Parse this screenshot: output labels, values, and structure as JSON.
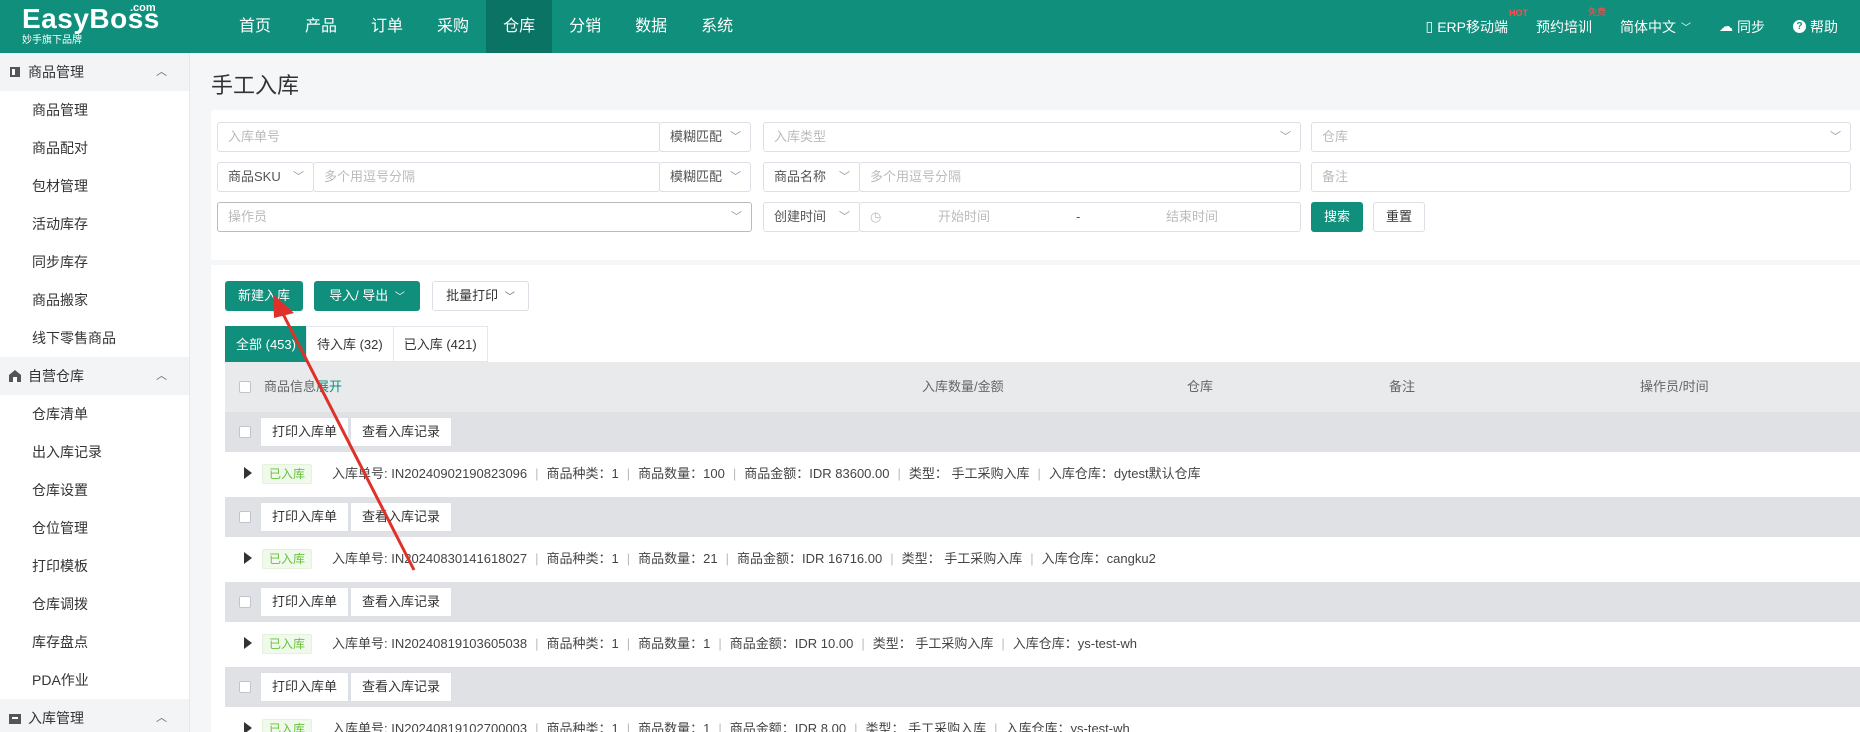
{
  "brand": {
    "name": "EasyBoss",
    "com": ".com",
    "sub": "妙手旗下品牌"
  },
  "nav": [
    "首页",
    "产品",
    "订单",
    "采购",
    "仓库",
    "分销",
    "数据",
    "系统"
  ],
  "nav_active": "仓库",
  "right_nav": {
    "erp": "ERP移动端",
    "erp_badge": "HOT",
    "train": "预约培训",
    "train_badge": "免费",
    "lang": "简体中文",
    "sync": "同步",
    "help": "帮助"
  },
  "sidebar": {
    "groups": [
      {
        "title": "商品管理",
        "icon": "product-icon",
        "items": [
          "商品管理",
          "商品配对",
          "包材管理",
          "活动库存",
          "同步库存",
          "商品搬家",
          "线下零售商品"
        ]
      },
      {
        "title": "自营仓库",
        "icon": "warehouse-icon",
        "items": [
          "仓库清单",
          "出入库记录",
          "仓库设置",
          "仓位管理",
          "打印模板",
          "仓库调拨",
          "库存盘点",
          "PDA作业"
        ]
      },
      {
        "title": "入库管理",
        "icon": "inbound-icon",
        "items": []
      }
    ]
  },
  "page": {
    "title": "手工入库"
  },
  "filters": {
    "order_no_placeholder": "入库单号",
    "fuzzy_match": "模糊匹配",
    "inbound_type_placeholder": "入库类型",
    "warehouse_placeholder": "仓库",
    "sku_label": "商品SKU",
    "multi_placeholder": "多个用逗号分隔",
    "product_name_label": "商品名称",
    "remark_placeholder": "备注",
    "operator_placeholder": "操作员",
    "time_type": "创建时间",
    "start_time": "开始时间",
    "end_time": "结束时间",
    "range_sep": "-",
    "search": "搜索",
    "reset": "重置"
  },
  "toolbar": {
    "new_inbound": "新建入库",
    "import_export": "导入/ 导出",
    "batch_print": "批量打印"
  },
  "tabs": [
    {
      "label": "全部 (453)",
      "active": true
    },
    {
      "label": "待入库 (32)",
      "active": false
    },
    {
      "label": "已入库 (421)",
      "active": false
    }
  ],
  "table_header": {
    "product_info": "商品信息",
    "expand": "展开",
    "qty_amount": "入库数量/金额",
    "warehouse": "仓库",
    "remark": "备注",
    "operator_time": "操作员/时间"
  },
  "group_buttons": {
    "print": "打印入库单",
    "records": "查看入库记录"
  },
  "records": [
    {
      "status": "已入库",
      "order_no": "入库单号: IN20240902190823096",
      "kinds": "商品种类：1",
      "qty": "商品数量：100",
      "amount": "商品金额：IDR 83600.00",
      "type": "类型：  手工采购入库",
      "warehouse": "入库仓库：dytest默认仓库"
    },
    {
      "status": "已入库",
      "order_no": "入库单号: IN20240830141618027",
      "kinds": "商品种类：1",
      "qty": "商品数量：21",
      "amount": "商品金额：IDR 16716.00",
      "type": "类型：  手工采购入库",
      "warehouse": "入库仓库：cangku2"
    },
    {
      "status": "已入库",
      "order_no": "入库单号: IN20240819103605038",
      "kinds": "商品种类：1",
      "qty": "商品数量：1",
      "amount": "商品金额：IDR 10.00",
      "type": "类型：  手工采购入库",
      "warehouse": "入库仓库：ys-test-wh"
    },
    {
      "status": "已入库",
      "order_no": "入库单号: IN20240819102700003",
      "kinds": "商品种类：1",
      "qty": "商品数量：1",
      "amount": "商品金额：IDR 8.00",
      "type": "类型：  手工采购入库",
      "warehouse": "入库仓库：ys-test-wh"
    }
  ],
  "colors": {
    "brand": "#0f8f7c",
    "brand_dark": "#0a7364",
    "annotation_arrow": "#e0302a"
  }
}
